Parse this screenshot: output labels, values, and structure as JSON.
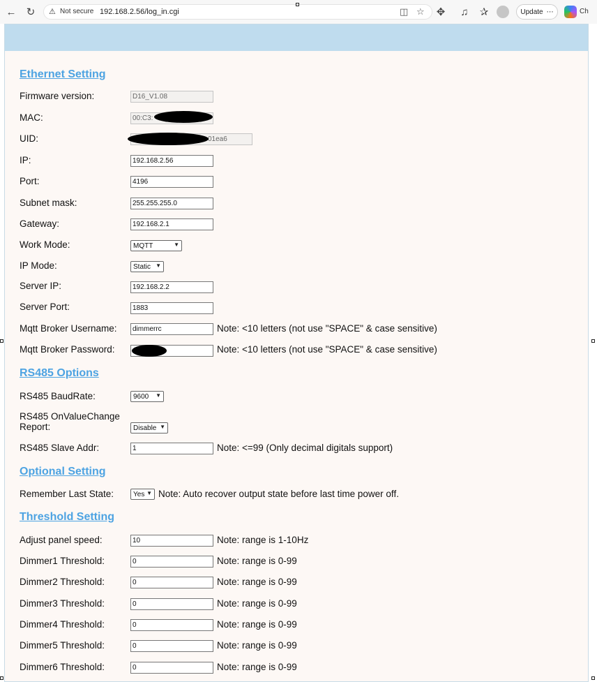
{
  "browser": {
    "security_label": "Not secure",
    "url": "192.168.2.56/log_in.cgi",
    "update_label": "Update",
    "copilot_label": "Ch"
  },
  "ethernet": {
    "title": "Ethernet Setting",
    "firmware_label": "Firmware version:",
    "firmware_value": "D16_V1.08",
    "mac_label": "MAC:",
    "mac_value": "00:C3:",
    "uid_label": "UID:",
    "uid_value": "01ea6",
    "ip_label": "IP:",
    "ip_value": "192.168.2.56",
    "port_label": "Port:",
    "port_value": "4196",
    "subnet_label": "Subnet mask:",
    "subnet_value": "255.255.255.0",
    "gateway_label": "Gateway:",
    "gateway_value": "192.168.2.1",
    "workmode_label": "Work Mode:",
    "workmode_value": "MQTT",
    "ipmode_label": "IP Mode:",
    "ipmode_value": "Static",
    "serverip_label": "Server IP:",
    "serverip_value": "192.168.2.2",
    "serverport_label": "Server Port:",
    "serverport_value": "1883",
    "mqtt_user_label": "Mqtt Broker Username:",
    "mqtt_user_value": "dimmerrc",
    "mqtt_user_note": "Note: <10 letters (not use \"SPACE\" & case sensitive)",
    "mqtt_pass_label": "Mqtt Broker Password:",
    "mqtt_pass_note": "Note: <10 letters (not use \"SPACE\" & case sensitive)"
  },
  "rs485": {
    "title": "RS485 Options",
    "baud_label": "RS485 BaudRate:",
    "baud_value": "9600",
    "onchange_label_1": "RS485 OnValueChange",
    "onchange_label_2": "Report:",
    "onchange_value": "Disable",
    "slave_label": "RS485 Slave Addr:",
    "slave_value": "1",
    "slave_note": "Note: <=99 (Only decimal digitals support)"
  },
  "optional": {
    "title": "Optional Setting",
    "remember_label": "Remember Last State:",
    "remember_value": "Yes",
    "remember_note": "Note: Auto recover output state before last time power off."
  },
  "threshold": {
    "title": "Threshold Setting",
    "rows": [
      {
        "label": "Adjust panel speed:",
        "value": "10",
        "note": "Note: range is 1-10Hz"
      },
      {
        "label": "Dimmer1 Threshold:",
        "value": "0",
        "note": "Note: range is 0-99"
      },
      {
        "label": "Dimmer2 Threshold:",
        "value": "0",
        "note": "Note: range is 0-99"
      },
      {
        "label": "Dimmer3 Threshold:",
        "value": "0",
        "note": "Note: range is 0-99"
      },
      {
        "label": "Dimmer4 Threshold:",
        "value": "0",
        "note": "Note: range is 0-99"
      },
      {
        "label": "Dimmer5 Threshold:",
        "value": "0",
        "note": "Note: range is 0-99"
      },
      {
        "label": "Dimmer6 Threshold:",
        "value": "0",
        "note": "Note: range is 0-99"
      }
    ]
  }
}
